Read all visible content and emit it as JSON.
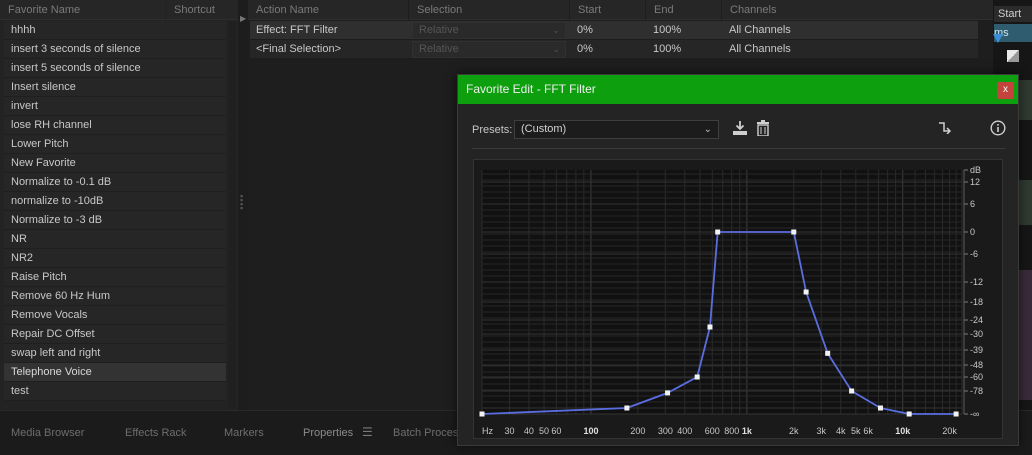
{
  "favorites": {
    "headers": {
      "name": "Favorite Name",
      "shortcut": "Shortcut"
    },
    "items": [
      "hhhh",
      "insert 3 seconds of silence",
      "insert 5 seconds of silence",
      "Insert silence",
      "invert",
      "lose RH channel",
      "Lower Pitch",
      "New Favorite",
      "Normalize to -0.1 dB",
      "normalize to -10dB",
      "Normalize to -3 dB",
      "NR",
      "NR2",
      "Raise Pitch",
      "Remove 60 Hz Hum",
      "Remove Vocals",
      "Repair DC Offset",
      "swap left and right",
      "Telephone Voice",
      "test"
    ],
    "selected_index": 18
  },
  "actions": {
    "headers": {
      "name": "Action Name",
      "selection": "Selection",
      "start": "Start",
      "end": "End",
      "channels": "Channels"
    },
    "rows": [
      {
        "name": "Effect: FFT Filter",
        "selection": "Relative",
        "start": "0%",
        "end": "100%",
        "channels": "All Channels"
      },
      {
        "name": "<Final Selection>",
        "selection": "Relative",
        "start": "0%",
        "end": "100%",
        "channels": "All Channels"
      }
    ]
  },
  "tabs": [
    "Media Browser",
    "Effects Rack",
    "Markers",
    "Properties",
    "Batch Proces"
  ],
  "active_tab": "Properties",
  "right_strip": {
    "start_label": "Start",
    "time_label": "ms"
  },
  "dialog": {
    "title": "Favorite Edit - FFT Filter",
    "close": "x",
    "presets_label": "Presets:",
    "presets_value": "(Custom)",
    "icons": [
      "download-icon",
      "trash-icon",
      "route-icon",
      "info-icon"
    ],
    "title_color": "#0d9f0d",
    "curve_color": "#5b6ee0"
  },
  "chart_data": {
    "type": "line",
    "xscale": "log",
    "xlim": [
      20,
      24000
    ],
    "ylabel": "dB",
    "x_tick_labels": [
      "Hz",
      "30",
      "40",
      "50",
      "60",
      "100",
      "200",
      "300",
      "400",
      "600",
      "800",
      "1k",
      "2k",
      "3k",
      "4k",
      "5k",
      "6k",
      "10k",
      "20k"
    ],
    "y_tick_labels": [
      "dB",
      "12",
      "6",
      "0",
      "-6",
      "-12",
      "-18",
      "-24",
      "-30",
      "-39",
      "-48",
      "-60",
      "-78",
      "-∞"
    ],
    "series": [
      {
        "points": [
          {
            "x": 20,
            "y": "-∞"
          },
          {
            "x": 170,
            "y": -96
          },
          {
            "x": 310,
            "y": -80
          },
          {
            "x": 480,
            "y": -60
          },
          {
            "x": 580,
            "y": -27
          },
          {
            "x": 650,
            "y": 0
          },
          {
            "x": 2000,
            "y": 0
          },
          {
            "x": 2400,
            "y": -15
          },
          {
            "x": 3300,
            "y": -41
          },
          {
            "x": 4700,
            "y": -78
          },
          {
            "x": 7200,
            "y": -96
          },
          {
            "x": 11000,
            "y": "-∞"
          },
          {
            "x": 22000,
            "y": "-∞"
          }
        ]
      }
    ]
  }
}
